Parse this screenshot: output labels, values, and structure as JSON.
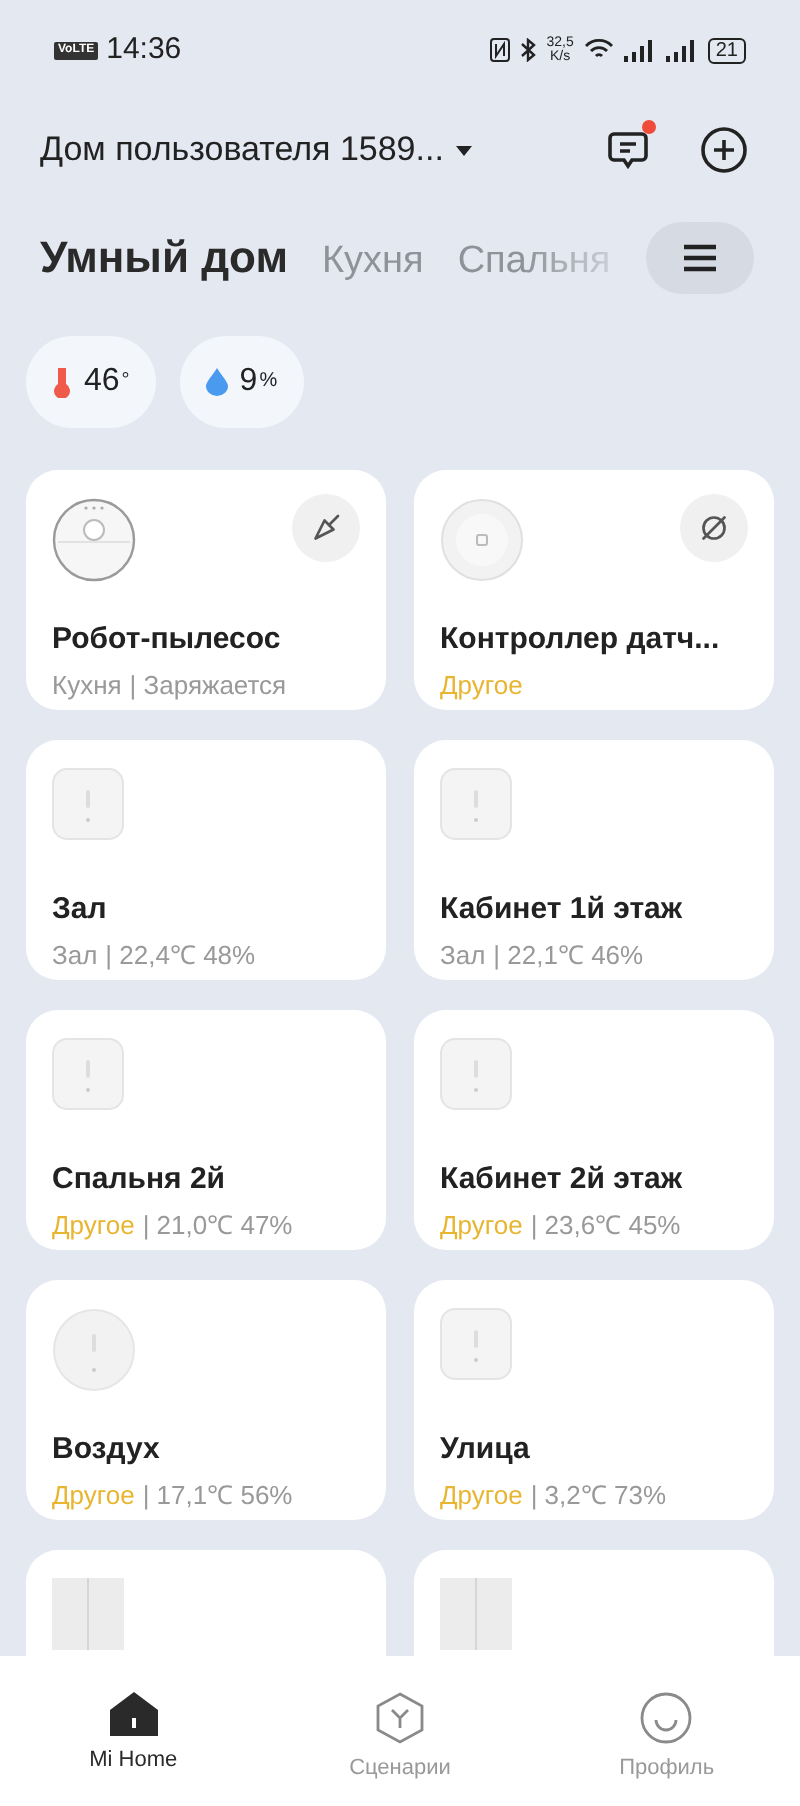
{
  "status_bar": {
    "network_badge": "VoLTE",
    "time": "14:36",
    "speed_value": "32,5",
    "speed_unit": "K/s",
    "battery": "21"
  },
  "header": {
    "home_name": "Дом пользователя 1589...",
    "has_notification": true
  },
  "tabs": [
    {
      "label": "Умный дом",
      "selected": true
    },
    {
      "label": "Кухня",
      "selected": false
    },
    {
      "label": "Спальня",
      "selected": false
    }
  ],
  "chips": [
    {
      "kind": "temperature",
      "value": "46",
      "unit": "°"
    },
    {
      "kind": "humidity",
      "value": "9",
      "unit": "%"
    }
  ],
  "devices": [
    {
      "kind": "vacuum",
      "name": "Робот-пылесос",
      "room": "Кухня",
      "room_other": false,
      "detail": "| Заряжается",
      "action": {
        "kind": "clean"
      }
    },
    {
      "kind": "hub",
      "name": "Контроллер датч...",
      "room": "Другое",
      "room_other": true,
      "action": {
        "kind": "offline"
      }
    },
    {
      "kind": "square",
      "name": "Зал",
      "room": "Зал",
      "room_other": false,
      "detail": "| 22,4℃ 48%"
    },
    {
      "kind": "square",
      "name": "Кабинет 1й этаж",
      "room": "Зал",
      "room_other": false,
      "detail": "| 22,1℃ 46%"
    },
    {
      "kind": "square",
      "name": "Спальня 2й",
      "room": "Другое",
      "room_other": true,
      "detail": "| 21,0℃ 47%"
    },
    {
      "kind": "square",
      "name": "Кабинет 2й этаж",
      "room": "Другое",
      "room_other": true,
      "detail": "| 23,6℃ 45%"
    },
    {
      "kind": "round",
      "name": "Воздух",
      "room": "Другое",
      "room_other": true,
      "detail": "| 17,1℃ 56%"
    },
    {
      "kind": "square",
      "name": "Улица",
      "room": "Другое",
      "room_other": true,
      "detail": "| 3,2℃ 73%"
    },
    {
      "kind": "switch"
    },
    {
      "kind": "switch"
    }
  ],
  "nav": [
    {
      "kind": "home",
      "label": "Mi Home",
      "selected": true
    },
    {
      "kind": "scenes",
      "label": "Сценарии",
      "selected": false
    },
    {
      "kind": "profile",
      "label": "Профиль",
      "selected": false
    }
  ]
}
